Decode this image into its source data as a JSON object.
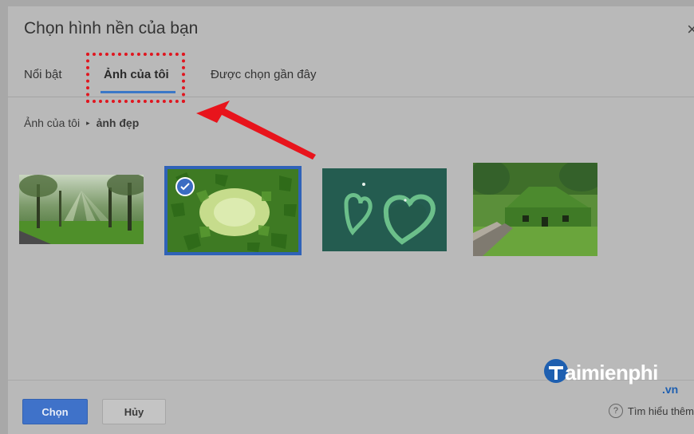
{
  "dialog": {
    "title": "Chọn hình nền của bạn",
    "close_glyph": "×"
  },
  "tabs": [
    {
      "label": "Nổi bật",
      "active": false
    },
    {
      "label": "Ảnh của tôi",
      "active": true
    },
    {
      "label": "Được chọn gần đây",
      "active": false
    }
  ],
  "breadcrumb": {
    "root": "Ảnh của tôi",
    "separator": "▸",
    "current": "ảnh đẹp"
  },
  "thumbnails": [
    {
      "name": "forest-sunbeams",
      "selected": false
    },
    {
      "name": "green-leaves",
      "selected": true
    },
    {
      "name": "heart-islands",
      "selected": false
    },
    {
      "name": "ivy-cottage",
      "selected": false
    }
  ],
  "footer": {
    "primary_label": "Chọn",
    "secondary_label": "Hủy",
    "help_icon_glyph": "?",
    "help_label": "Tìm hiểu thêm"
  },
  "watermark": {
    "text": "aimienphi",
    "suffix": ".vn"
  },
  "colors": {
    "accent": "#3f72c9",
    "highlight": "#e0161f",
    "selection": "#2f62b8"
  }
}
